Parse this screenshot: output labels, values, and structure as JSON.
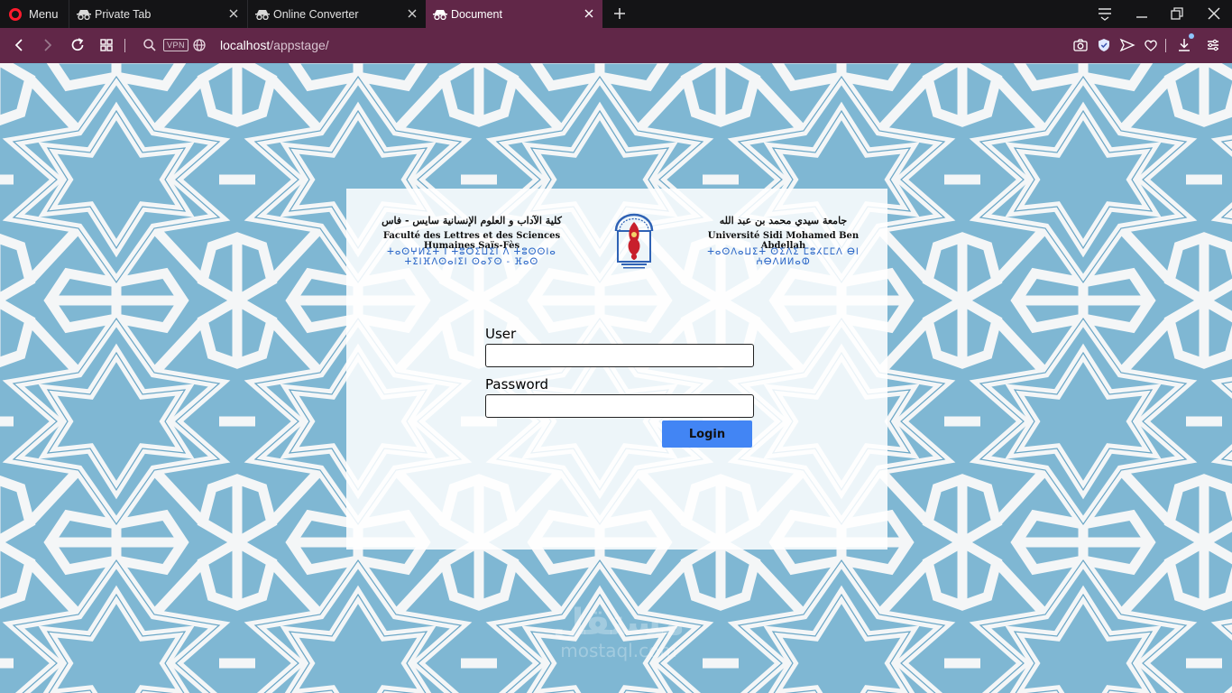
{
  "browser": {
    "menu_label": "Menu",
    "tabs": [
      {
        "title": "Private Tab",
        "active": false
      },
      {
        "title": "Online Converter",
        "active": false
      },
      {
        "title": "Document",
        "active": true
      }
    ],
    "url_host": "localhost",
    "url_path": "/appstage/",
    "vpn_label": "VPN"
  },
  "header": {
    "left": {
      "arabic": "كلية الآداب و العلوم الإنسانية سايس - فاس",
      "french": "Faculté des Lettres et des Sciences Humaines Saïs-Fès",
      "tifinagh": "ⵜⴰⵙⵖⵍⵉⵜ ⵏ ⵜⵓⵔⵉⵡⵉⵏ ⴷ ⵜⵓⵙⵙⵏⴰ ⵜⵉⵏⴼⴷⵙⴰⵏⵉⵏ ⵙⴰⵢⵙ - ⴼⴰⵙ"
    },
    "right": {
      "arabic": "جامعة سيدي محمد بن عبد الله",
      "french": "Université Sidi Mohamed Ben Abdellah",
      "tifinagh": "ⵜⴰⵙⴷⴰⵡⵉⵜ ⵙⵉⴷⵉ ⵎⵓⵃⵎⵎⴷ ⴱⵏ ⵄⴱⴷⵍⵍⴰⵀ"
    }
  },
  "login": {
    "user_label": "User",
    "user_value": "",
    "password_label": "Password",
    "password_value": "",
    "button_label": "Login"
  },
  "watermark": {
    "arabic": "مستقل",
    "latin": "mostaql.com"
  },
  "colors": {
    "browser_accent": "#612748",
    "tile_blue": "#7fb7d3",
    "login_button": "#4285f4"
  }
}
